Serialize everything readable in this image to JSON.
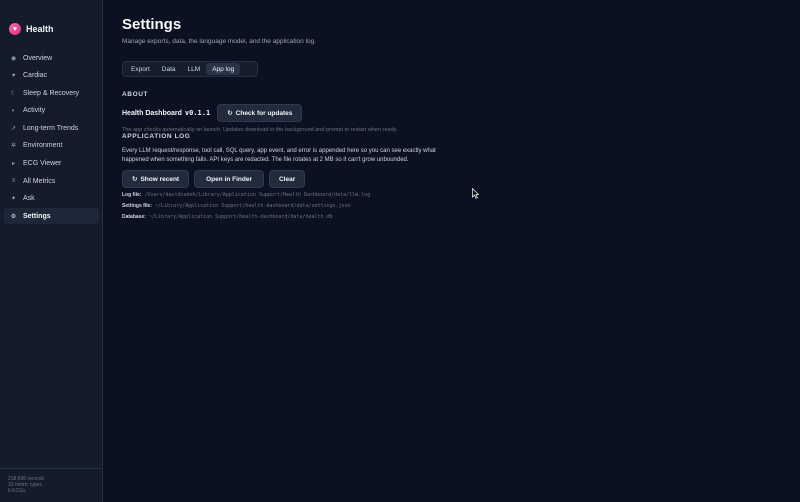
{
  "brand": {
    "icon": "heart-icon",
    "name": "Health",
    "accent": "#ec4899"
  },
  "sidebar": {
    "items": [
      {
        "label": "Overview",
        "icon": "grid-icon",
        "glyph": "◉"
      },
      {
        "label": "Cardiac",
        "icon": "heart-icon",
        "glyph": "♥"
      },
      {
        "label": "Sleep & Recovery",
        "icon": "moon-icon",
        "glyph": "☾"
      },
      {
        "label": "Activity",
        "icon": "activity-icon",
        "glyph": "◐"
      },
      {
        "label": "Long-term Trends",
        "icon": "trend-icon",
        "glyph": "↗"
      },
      {
        "label": "Environment",
        "icon": "sun-icon",
        "glyph": "✲"
      },
      {
        "label": "ECG Viewer",
        "icon": "play-icon",
        "glyph": "▸"
      },
      {
        "label": "All Metrics",
        "icon": "list-icon",
        "glyph": "≡"
      },
      {
        "label": "Ask",
        "icon": "sparkle-icon",
        "glyph": "✦"
      },
      {
        "label": "Settings",
        "icon": "gear-icon",
        "glyph": "⚙",
        "active": true
      }
    ],
    "footer": {
      "records": "218,836 records",
      "types": "33 metric types",
      "ecgs": "6 ECGs"
    }
  },
  "page": {
    "title": "Settings",
    "subtitle": "Manage exports, data, the language model, and the application log."
  },
  "tabs": [
    {
      "label": "Export"
    },
    {
      "label": "Data"
    },
    {
      "label": "LLM"
    },
    {
      "label": "App log",
      "active": true
    }
  ],
  "about": {
    "heading": "ABOUT",
    "app_name": "Health Dashboard",
    "version": "v0.1.1",
    "check_updates_label": "Check for updates",
    "note": "The app checks automatically on launch. Updates download in the background and prompt to restart when ready."
  },
  "app_log": {
    "heading": "APPLICATION LOG",
    "description": "Every LLM request/response, tool call, SQL query, app event, and error is appended here so you can see exactly what happened when something fails. API keys are redacted. The file rotates at 2 MB so it can't grow unbounded.",
    "show_recent_label": "Show recent",
    "open_finder_label": "Open in Finder",
    "clear_label": "Clear",
    "paths": [
      {
        "label": "Log file:",
        "value": "/Users/davidsadeh/Library/Application Support/Health Dashboard/data/llm.log"
      },
      {
        "label": "Settings file:",
        "value": "~/Library/Application Support/health-dashboard/data/settings.json"
      },
      {
        "label": "Database:",
        "value": "~/Library/Application Support/health-dashboard/data/health.db"
      }
    ]
  },
  "colors": {
    "background": "#0b1120",
    "sidebar": "#141b2b",
    "button": "#222b3c",
    "accent": "#ec4899"
  }
}
